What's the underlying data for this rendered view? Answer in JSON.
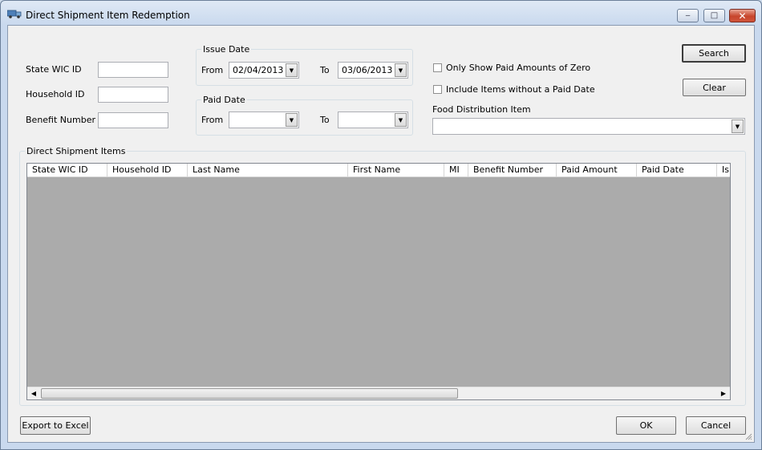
{
  "window": {
    "title": "Direct Shipment Item Redemption",
    "buttons": {
      "minimize": "‒",
      "maximize": "□",
      "close": "✕"
    }
  },
  "filters": {
    "state_wic_id": {
      "label": "State WIC ID",
      "value": ""
    },
    "household_id": {
      "label": "Household ID",
      "value": ""
    },
    "benefit_number": {
      "label": "Benefit Number",
      "value": ""
    }
  },
  "issue_date": {
    "title": "Issue Date",
    "from_label": "From",
    "from_value": "02/04/2013",
    "to_label": "To",
    "to_value": "03/06/2013"
  },
  "paid_date": {
    "title": "Paid Date",
    "from_label": "From",
    "from_value": "",
    "to_label": "To",
    "to_value": ""
  },
  "options": {
    "only_zero_label": "Only Show Paid Amounts of Zero",
    "only_zero_checked": false,
    "include_no_paid_label": "Include Items without a Paid Date",
    "include_no_paid_checked": false
  },
  "food_item": {
    "label": "Food Distribution Item",
    "value": ""
  },
  "actions": {
    "search": "Search",
    "clear": "Clear"
  },
  "items": {
    "title": "Direct Shipment Items",
    "columns": [
      "State WIC ID",
      "Household ID",
      "Last Name",
      "First Name",
      "MI",
      "Benefit Number",
      "Paid Amount",
      "Paid Date",
      "Is"
    ],
    "rows": []
  },
  "footer": {
    "export": "Export to Excel",
    "ok": "OK",
    "cancel": "Cancel"
  },
  "colors": {
    "grid_background": "#ababab",
    "dialog_background": "#f0f0f0"
  },
  "icons": {
    "app": "truck-icon",
    "dropdown": "chevron-down-icon",
    "scroll_left": "arrow-left-icon",
    "scroll_right": "arrow-right-icon"
  }
}
